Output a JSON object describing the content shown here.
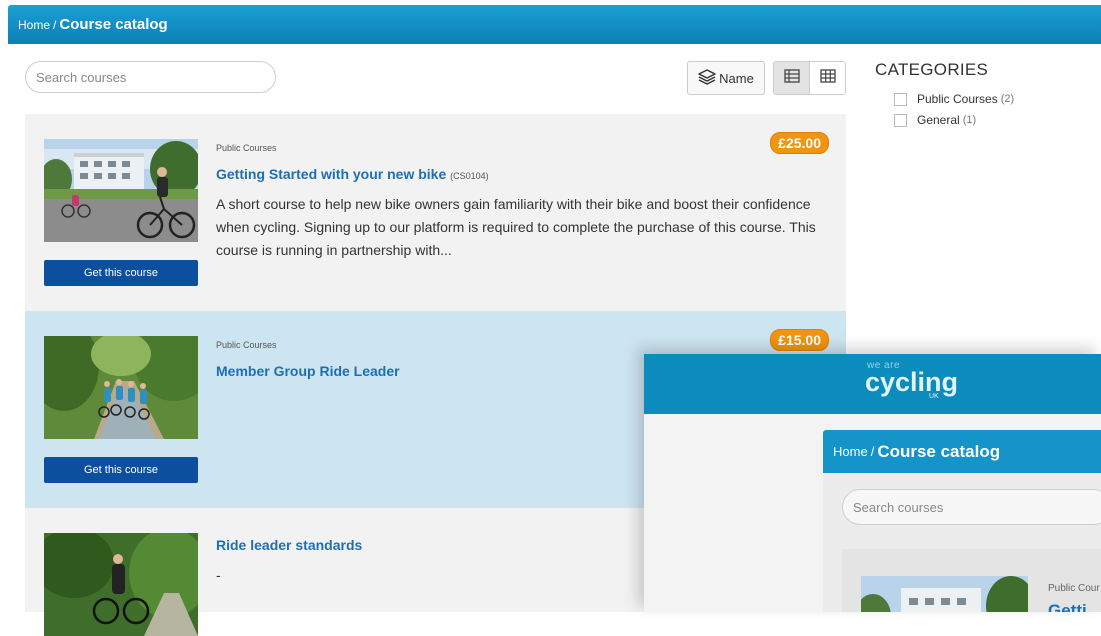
{
  "breadcrumb": {
    "home": "Home",
    "separator": "/",
    "current": "Course catalog"
  },
  "search": {
    "placeholder": "Search courses"
  },
  "sort": {
    "label": "Name",
    "icon": "layers-icon"
  },
  "view_toggle": {
    "options": [
      "list-view-icon",
      "grid-view-icon"
    ],
    "active": "list-view-icon"
  },
  "categories": {
    "title": "CATEGORIES",
    "items": [
      {
        "label": "Public Courses",
        "count": "(2)"
      },
      {
        "label": "General",
        "count": "(1)"
      }
    ]
  },
  "courses": [
    {
      "category": "Public Courses",
      "title": "Getting Started with your new bike",
      "code": "(CS0104)",
      "description": "A short course to help new bike owners gain familiarity with their bike and boost their confidence when cycling. Signing up to our platform is required to complete the purchase of this course. This course is running in partnership with...",
      "price": "£25.00",
      "button": "Get this course"
    },
    {
      "category": "Public Courses",
      "title": "Member Group Ride Leader",
      "code": "",
      "description": "",
      "price": "£15.00",
      "button": "Get this course"
    },
    {
      "category": "",
      "title": "Ride leader standards",
      "code": "",
      "description": "-",
      "price": "",
      "button": ""
    }
  ],
  "overlay": {
    "logo_top": "we are",
    "logo_main": "cycling",
    "logo_sub": "UK",
    "breadcrumb_home": "Home",
    "breadcrumb_separator": "/",
    "breadcrumb_current": "Course catalog",
    "search_placeholder": "Search courses",
    "card_category": "Public Cour",
    "card_title": "Getti"
  },
  "colors": {
    "header": "#0b7fb6",
    "link": "#1d6fb5",
    "price_badge": "#f0950f",
    "button": "#0b4f9e",
    "row_highlight": "#cde5f1"
  }
}
